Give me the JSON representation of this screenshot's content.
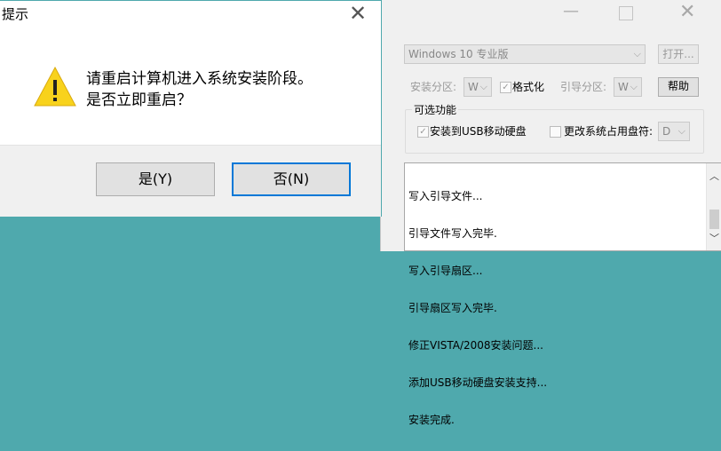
{
  "installer": {
    "edition_select": "Windows 10 专业版",
    "open_button": "打开...",
    "install_partition_label": "安装分区:",
    "install_partition_value": "W",
    "format_label": "格式化",
    "boot_partition_label": "引导分区:",
    "boot_partition_value": "W",
    "help_button": "帮助",
    "optional_group_title": "可选功能",
    "usb_install_label": "安装到USB移动硬盘",
    "change_drive_letter_label": "更改系统占用盘符:",
    "drive_letter_value": "D",
    "log_lines": [
      "写入引导文件...",
      "引导文件写入完毕.",
      "写入引导扇区...",
      "引导扇区写入完毕.",
      "修正VISTA/2008安装问题...",
      "添加USB移动硬盘安装支持...",
      "安装完成."
    ]
  },
  "dialog": {
    "title": "提示",
    "message_line1": "请重启计算机进入系统安装阶段。",
    "message_line2": "是否立即重启？",
    "yes_button": "是(Y)",
    "no_button": "否(N)"
  },
  "colors": {
    "desktop": "#4fa9ad",
    "focus_border": "#0078d7",
    "warning_yellow": "#f8d21c"
  },
  "icons": {
    "warning": "warning-icon",
    "close": "close-icon",
    "minimize": "minimize-icon",
    "maximize": "maximize-icon"
  }
}
